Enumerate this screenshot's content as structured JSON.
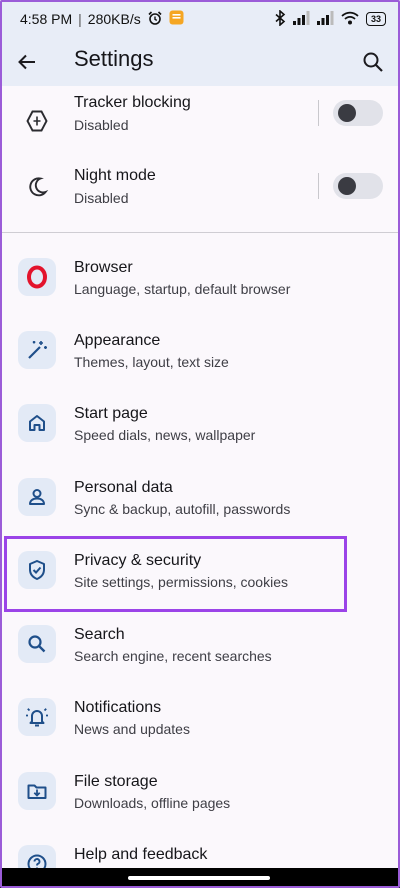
{
  "status_bar": {
    "time": "4:58 PM",
    "net_speed": "280KB/s",
    "battery_level": "33"
  },
  "app_bar": {
    "title": "Settings"
  },
  "toggles": [
    {
      "title": "Tracker blocking",
      "subtitle": "Disabled",
      "enabled": false,
      "icon": "tracker-shield-icon"
    },
    {
      "title": "Night mode",
      "subtitle": "Disabled",
      "enabled": false,
      "icon": "moon-icon"
    }
  ],
  "items": [
    {
      "title": "Browser",
      "subtitle": "Language, startup, default browser",
      "icon": "opera-logo-icon"
    },
    {
      "title": "Appearance",
      "subtitle": "Themes, layout, text size",
      "icon": "magic-wand-icon"
    },
    {
      "title": "Start page",
      "subtitle": "Speed dials, news, wallpaper",
      "icon": "home-icon"
    },
    {
      "title": "Personal data",
      "subtitle": "Sync & backup, autofill, passwords",
      "icon": "person-icon"
    },
    {
      "title": "Privacy & security",
      "subtitle": "Site settings, permissions, cookies",
      "icon": "shield-check-icon"
    },
    {
      "title": "Search",
      "subtitle": "Search engine, recent searches",
      "icon": "search-icon"
    },
    {
      "title": "Notifications",
      "subtitle": "News and updates",
      "icon": "alarm-bell-icon"
    },
    {
      "title": "File storage",
      "subtitle": "Downloads, offline pages",
      "icon": "download-folder-icon"
    },
    {
      "title": "Help and feedback",
      "subtitle": "",
      "icon": "help-icon"
    }
  ],
  "colors": {
    "highlight": "#9b44e8",
    "header_bg": "#e8edf7",
    "icon_tint": "#1f4f8a",
    "opera_red": "#e3132c"
  }
}
